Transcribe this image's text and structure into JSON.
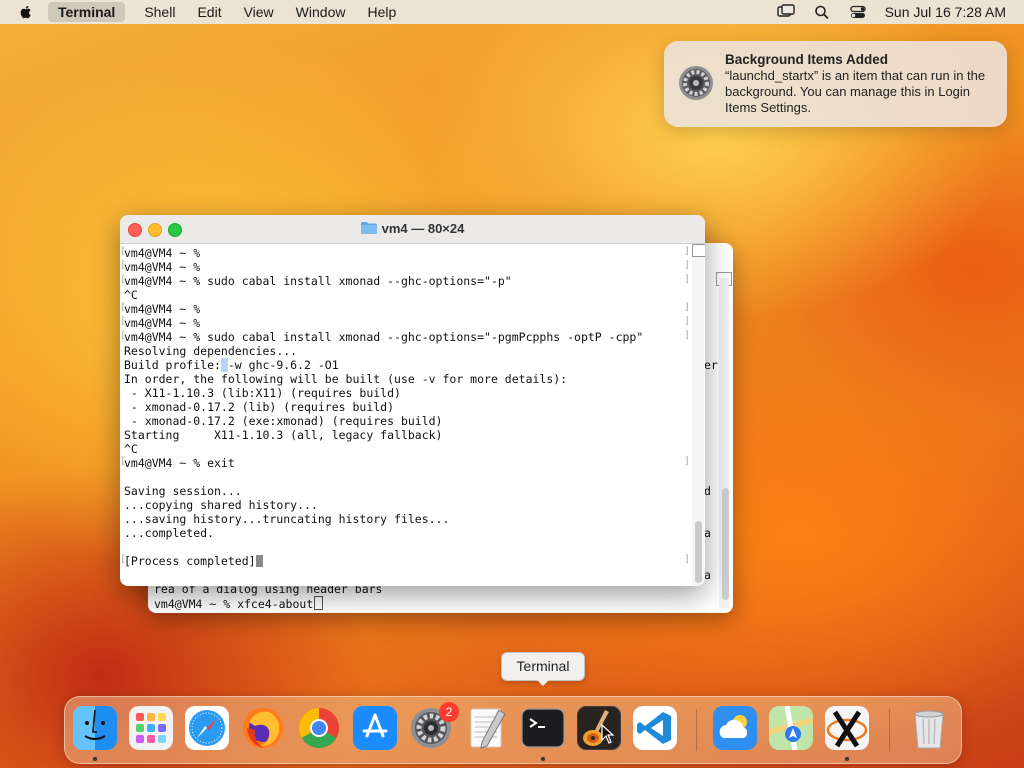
{
  "menubar": {
    "app_name": "Terminal",
    "items": [
      "Shell",
      "Edit",
      "View",
      "Window",
      "Help"
    ],
    "clock": "Sun Jul 16  7:28 AM"
  },
  "notification": {
    "title": "Background Items Added",
    "body": "“launchd_startx” is an item that can run in the background. You can manage this in Login Items Settings."
  },
  "front_window": {
    "title": "vm4 — 80×24",
    "lines": [
      "vm4@VM4 ~ %",
      "vm4@VM4 ~ %",
      "vm4@VM4 ~ % sudo cabal install xmonad --ghc-options=\"-p\"",
      "^C",
      "vm4@VM4 ~ %",
      "vm4@VM4 ~ %",
      "vm4@VM4 ~ % sudo cabal install xmonad --ghc-options=\"-pgmPcpphs -optP -cpp\"",
      "Resolving dependencies...",
      "Build profile:",
      "In order, the following will be built (use -v for more details):",
      " - X11-1.10.3 (lib:X11) (requires build)",
      " - xmonad-0.17.2 (lib) (requires build)",
      " - xmonad-0.17.2 (exe:xmonad) (requires build)",
      "Starting     X11-1.10.3 (all, legacy fallback)",
      "^C",
      "vm4@VM4 ~ % exit",
      "",
      "Saving session...",
      "...copying shared history...",
      "...saving history...truncating history files...",
      "...completed.",
      "",
      "[Process completed]"
    ],
    "build_profile_tail": "-w ghc-9.6.2 -O1"
  },
  "back_window": {
    "lines": [
      "rea of a dialog using header bars",
      "vm4@VM4 ~ % xfce4-about"
    ],
    "fragments": [
      "er",
      "d",
      "a",
      "a"
    ]
  },
  "tooltip": "Terminal",
  "dock": {
    "items": [
      {
        "name": "Finder",
        "icon": "finder-icon",
        "running": true
      },
      {
        "name": "Launchpad",
        "icon": "launchpad-icon",
        "running": false
      },
      {
        "name": "Safari",
        "icon": "safari-icon",
        "running": false
      },
      {
        "name": "Firefox",
        "icon": "firefox-icon",
        "running": false
      },
      {
        "name": "Chrome",
        "icon": "chrome-icon",
        "running": false
      },
      {
        "name": "App Store",
        "icon": "app-store-icon",
        "running": false
      },
      {
        "name": "System Settings",
        "icon": "system-settings-icon",
        "running": false,
        "badge": "2"
      },
      {
        "name": "TextEdit",
        "icon": "textedit-icon",
        "running": false
      },
      {
        "name": "Terminal",
        "icon": "terminal-icon",
        "running": true
      },
      {
        "name": "GarageBand",
        "icon": "garageband-icon",
        "running": false
      },
      {
        "name": "Visual Studio Code",
        "icon": "vscode-icon",
        "running": false
      },
      {
        "name": "Weather",
        "icon": "weather-icon",
        "running": false
      },
      {
        "name": "Maps",
        "icon": "maps-icon",
        "running": false
      },
      {
        "name": "XQuartz",
        "icon": "xquartz-icon",
        "running": true
      },
      {
        "name": "Trash",
        "icon": "trash-icon",
        "running": false
      }
    ]
  }
}
